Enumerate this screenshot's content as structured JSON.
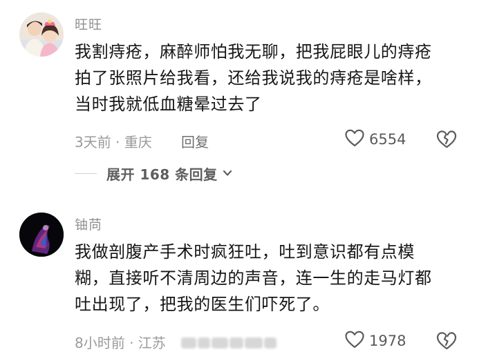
{
  "comments": [
    {
      "username": "旺旺",
      "lines": [
        "我割痔疮，麻醉师怕我无聊，把我屁眼儿的痔疮",
        "拍了张照片给我看，还给我说我的痔疮是啥样，",
        "当时我就低血糖晕过去了"
      ],
      "meta": "3天前 · 重庆",
      "reply_label": "回复",
      "likes": "6554",
      "expand_label": "展开 168 条回复"
    },
    {
      "username": "铀苘",
      "lines": [
        "我做剖腹产手术时疯狂吐，吐到意识都有点模",
        "糊，直接听不清周边的声音，连一生的走马灯都",
        "吐出现了，把我的医生们吓死了。"
      ],
      "meta": "8小时前 · 江苏",
      "likes": "1978"
    }
  ],
  "icons": {
    "like": "heart-outline-icon",
    "dislike": "broken-heart-icon",
    "expand": "chevron-down-icon"
  },
  "colors": {
    "text": "#161616",
    "meta": "#9a9a9a",
    "username": "#8f8f8f",
    "icon": "#5a5a5a"
  }
}
